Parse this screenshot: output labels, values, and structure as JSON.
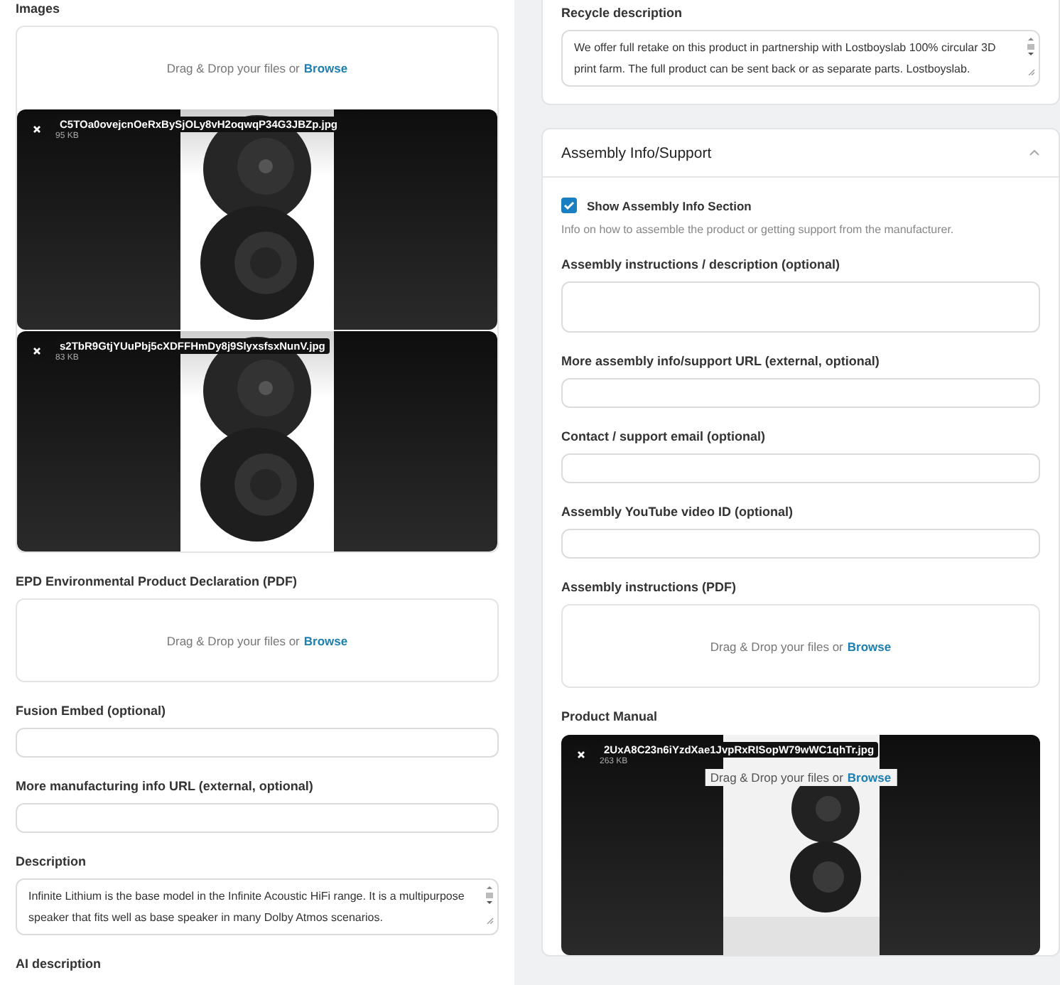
{
  "left_panel": {
    "fields": [
      {
        "kind": "upload",
        "label": "Images",
        "prompt": "Drag & Drop your files or",
        "link": "Browse",
        "files": [
          {
            "name": "C5TOa0ovejcnOeRxBySjOLy8vH2oqwqP34G3JBZp.jpg",
            "size": "95 KB"
          },
          {
            "name": "s2TbR9GtjYUuPbj5cXDFFHmDy8j9SlyxsfsxNunV.jpg",
            "size": "83 KB"
          }
        ]
      },
      {
        "kind": "upload",
        "label": "EPD Environmental Product Declaration (PDF)",
        "prompt": "Drag & Drop your files or",
        "link": "Browse"
      },
      {
        "kind": "input",
        "label": "Fusion Embed (optional)"
      },
      {
        "kind": "input",
        "label": "More manufacturing info URL (external, optional)"
      },
      {
        "kind": "textarea",
        "label": "Description",
        "value": "Infinite Lithium is the base model in the Infinite Acoustic HiFi range. It is a multipurpose speaker that fits well as base speaker in many Dolby Atmos scenarios."
      },
      {
        "kind": "heading",
        "label": "AI description"
      }
    ]
  },
  "right_panel": {
    "recycle": {
      "fields": [
        {
          "kind": "textarea",
          "label": "Recycle description",
          "value": "We offer full retake on this product in partnership with Lostboyslab 100% circular 3D print farm. The full product can be sent back or as separate parts. Lostboyslab."
        }
      ]
    },
    "assembly": {
      "title": "Assembly Info/Support",
      "expanded": true,
      "checkbox": {
        "label": "Show Assembly Info Section",
        "checked": true
      },
      "help": "Info on how to assemble the product or getting support from the manufacturer.",
      "fields": [
        {
          "kind": "textarea",
          "label": "Assembly instructions / description (optional)"
        },
        {
          "kind": "input",
          "label": "More assembly info/support URL (external, optional)"
        },
        {
          "kind": "input",
          "label": "Contact / support email (optional)"
        },
        {
          "kind": "input",
          "label": "Assembly YouTube video ID (optional)"
        },
        {
          "kind": "upload",
          "label": "Assembly instructions (PDF)",
          "prompt": "Drag & Drop your files or",
          "link": "Browse"
        },
        {
          "kind": "upload_filled",
          "label": "Product Manual",
          "prompt": "Drag & Drop your files or",
          "link": "Browse",
          "files": [
            {
              "name": "2UxA8C23n6iYzdXae1JvpRxRISopW79wWC1qhTr.jpg",
              "size": "263 KB"
            }
          ]
        }
      ]
    }
  }
}
